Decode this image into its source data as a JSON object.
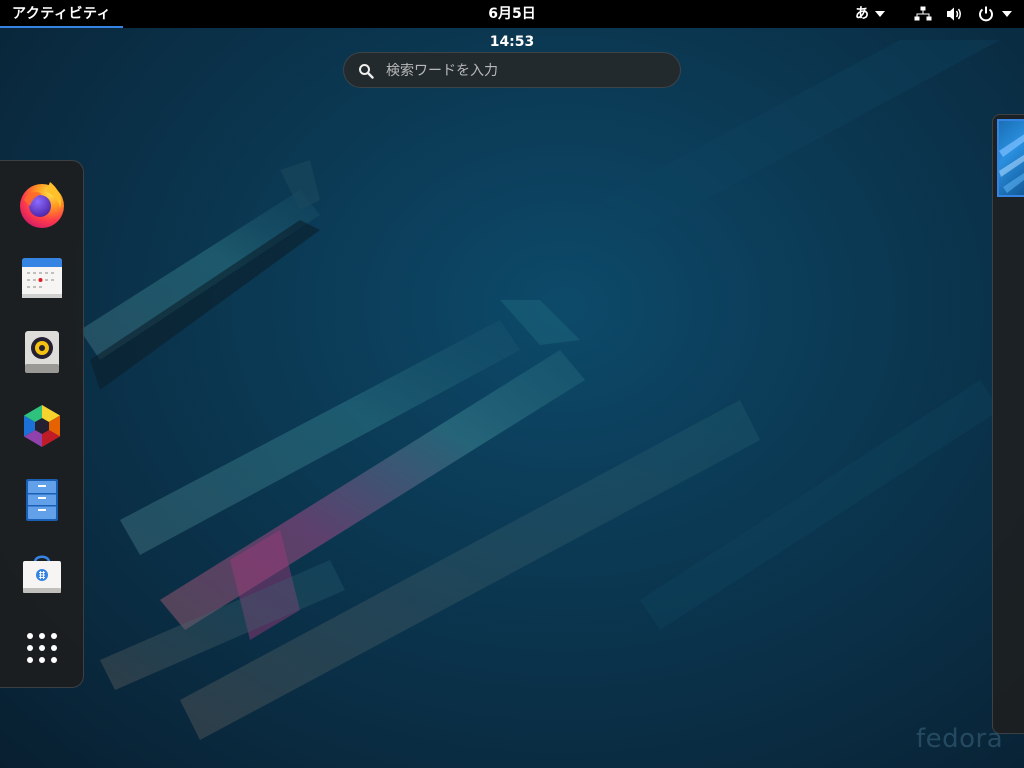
{
  "topbar": {
    "activities_label": "アクティビティ",
    "clock": "6月5日  14:53",
    "input_method": "あ",
    "icons": [
      "network-wired-icon",
      "volume-icon",
      "power-icon",
      "chevron-down-icon"
    ]
  },
  "search": {
    "placeholder": "検索ワードを入力",
    "icon": "search-icon"
  },
  "dash": {
    "items": [
      {
        "name": "firefox",
        "icon": "firefox-icon"
      },
      {
        "name": "calendar",
        "icon": "calendar-icon"
      },
      {
        "name": "rhythmbox",
        "icon": "speaker-icon"
      },
      {
        "name": "photos",
        "icon": "photos-icon"
      },
      {
        "name": "files",
        "icon": "file-cabinet-icon"
      },
      {
        "name": "software",
        "icon": "software-bag-icon"
      },
      {
        "name": "show-applications",
        "icon": "app-grid-icon"
      }
    ]
  },
  "wallpaper": {
    "watermark": "fedora"
  },
  "colors": {
    "accent": "#3584e4",
    "topbar_bg": "#000000",
    "dash_bg": "#1e1e1e"
  }
}
